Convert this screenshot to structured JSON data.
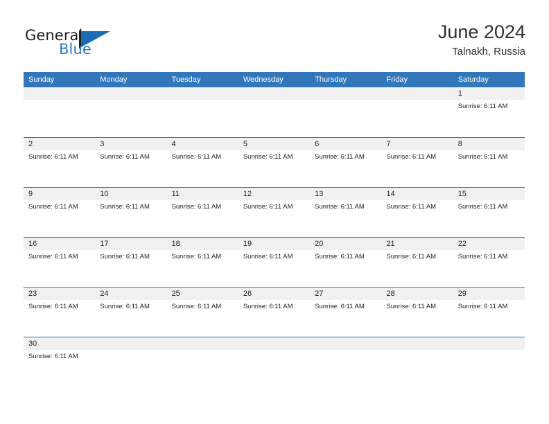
{
  "brand": {
    "name_part1": "General",
    "name_part2": "Blue",
    "mark": "blue-triangle-logo"
  },
  "header": {
    "title": "June 2024",
    "subtitle": "Talnakh, Russia"
  },
  "colors": {
    "header_blue": "#3276bb",
    "brand_blue": "#2b7cc0",
    "day_band_gray": "#f0f0f0",
    "text": "#231f20",
    "page_background": "#ffffff"
  },
  "calendar": {
    "weekdays": [
      "Sunday",
      "Monday",
      "Tuesday",
      "Wednesday",
      "Thursday",
      "Friday",
      "Saturday"
    ],
    "weeks": [
      [
        {
          "day": "",
          "events": []
        },
        {
          "day": "",
          "events": []
        },
        {
          "day": "",
          "events": []
        },
        {
          "day": "",
          "events": []
        },
        {
          "day": "",
          "events": []
        },
        {
          "day": "",
          "events": []
        },
        {
          "day": "1",
          "events": [
            "Sunrise: 6:11 AM"
          ]
        }
      ],
      [
        {
          "day": "2",
          "events": [
            "Sunrise: 6:11 AM"
          ]
        },
        {
          "day": "3",
          "events": [
            "Sunrise: 6:11 AM"
          ]
        },
        {
          "day": "4",
          "events": [
            "Sunrise: 6:11 AM"
          ]
        },
        {
          "day": "5",
          "events": [
            "Sunrise: 6:11 AM"
          ]
        },
        {
          "day": "6",
          "events": [
            "Sunrise: 6:11 AM"
          ]
        },
        {
          "day": "7",
          "events": [
            "Sunrise: 6:11 AM"
          ]
        },
        {
          "day": "8",
          "events": [
            "Sunrise: 6:11 AM"
          ]
        }
      ],
      [
        {
          "day": "9",
          "events": [
            "Sunrise: 6:11 AM"
          ]
        },
        {
          "day": "10",
          "events": [
            "Sunrise: 6:11 AM"
          ]
        },
        {
          "day": "11",
          "events": [
            "Sunrise: 6:11 AM"
          ]
        },
        {
          "day": "12",
          "events": [
            "Sunrise: 6:11 AM"
          ]
        },
        {
          "day": "13",
          "events": [
            "Sunrise: 6:11 AM"
          ]
        },
        {
          "day": "14",
          "events": [
            "Sunrise: 6:11 AM"
          ]
        },
        {
          "day": "15",
          "events": [
            "Sunrise: 6:11 AM"
          ]
        }
      ],
      [
        {
          "day": "16",
          "events": [
            "Sunrise: 6:11 AM"
          ]
        },
        {
          "day": "17",
          "events": [
            "Sunrise: 6:11 AM"
          ]
        },
        {
          "day": "18",
          "events": [
            "Sunrise: 6:11 AM"
          ]
        },
        {
          "day": "19",
          "events": [
            "Sunrise: 6:11 AM"
          ]
        },
        {
          "day": "20",
          "events": [
            "Sunrise: 6:11 AM"
          ]
        },
        {
          "day": "21",
          "events": [
            "Sunrise: 6:11 AM"
          ]
        },
        {
          "day": "22",
          "events": [
            "Sunrise: 6:11 AM"
          ]
        }
      ],
      [
        {
          "day": "23",
          "events": [
            "Sunrise: 6:11 AM"
          ]
        },
        {
          "day": "24",
          "events": [
            "Sunrise: 6:11 AM"
          ]
        },
        {
          "day": "25",
          "events": [
            "Sunrise: 6:11 AM"
          ]
        },
        {
          "day": "26",
          "events": [
            "Sunrise: 6:11 AM"
          ]
        },
        {
          "day": "27",
          "events": [
            "Sunrise: 6:11 AM"
          ]
        },
        {
          "day": "28",
          "events": [
            "Sunrise: 6:11 AM"
          ]
        },
        {
          "day": "29",
          "events": [
            "Sunrise: 6:11 AM"
          ]
        }
      ],
      [
        {
          "day": "30",
          "events": [
            "Sunrise: 6:11 AM"
          ]
        },
        {
          "day": "",
          "events": []
        },
        {
          "day": "",
          "events": []
        },
        {
          "day": "",
          "events": []
        },
        {
          "day": "",
          "events": []
        },
        {
          "day": "",
          "events": []
        },
        {
          "day": "",
          "events": []
        }
      ]
    ]
  }
}
